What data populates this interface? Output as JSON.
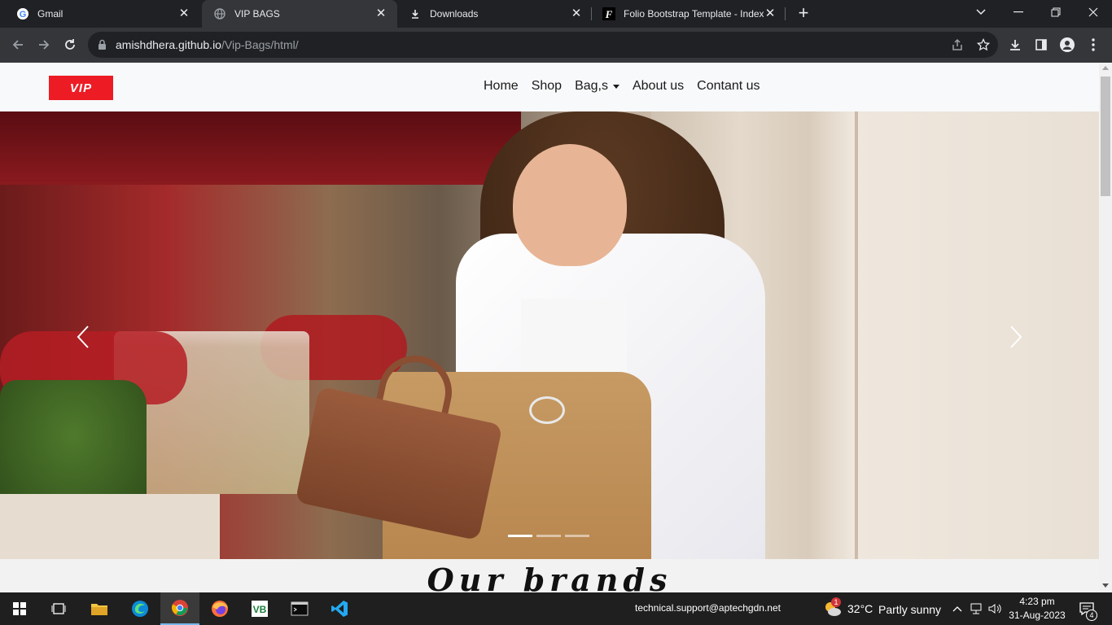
{
  "browser": {
    "tabs": [
      {
        "title": "Gmail",
        "favicon": "google-g-icon",
        "active": false
      },
      {
        "title": "VIP BAGS",
        "favicon": "globe-icon",
        "active": true
      },
      {
        "title": "Downloads",
        "favicon": "download-icon",
        "active": false
      },
      {
        "title": "Folio Bootstrap Template - Index",
        "favicon": "folio-f-icon",
        "active": false
      }
    ],
    "url_host": "amishdhera.github.io",
    "url_path": "/Vip-Bags/html/"
  },
  "site": {
    "logo_text": "VIP",
    "nav": {
      "home": "Home",
      "shop": "Shop",
      "bags": "Bag,s",
      "about": "About us",
      "contact": "Contant us"
    },
    "carousel": {
      "slide_count": 3,
      "active_slide": 1
    },
    "brands_heading": "Our brands"
  },
  "taskbar": {
    "support_email": "technical.support@aptechgdn.net",
    "weather_temp": "32°C",
    "weather_desc": "Partly sunny",
    "weather_badge": "1",
    "time": "4:23 pm",
    "date": "31-Aug-2023",
    "notification_count": "4"
  },
  "colors": {
    "brand_red": "#ed1c24",
    "chrome_dark": "#202124",
    "chrome_toolbar": "#35363a"
  }
}
